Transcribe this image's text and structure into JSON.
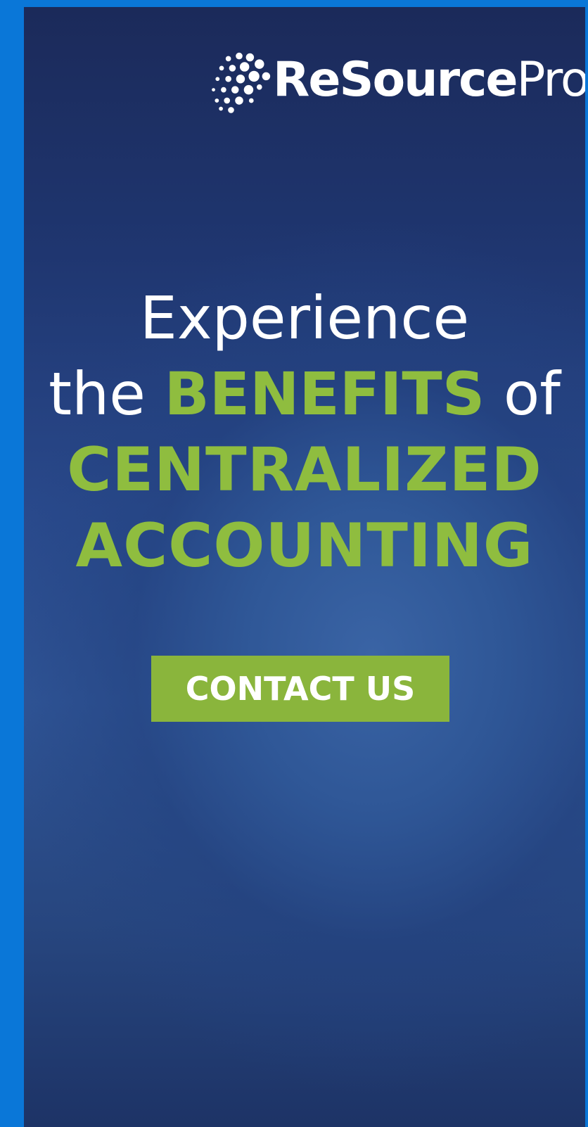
{
  "brand": {
    "name_bold": "ReSource",
    "name_light": "Pro",
    "logo_icon": "dotted-globe-icon",
    "frame_color": "#0a77d8",
    "background_dark": "#1b2a5a",
    "background_light": "#3a64a5"
  },
  "headline": {
    "line1": "Experience",
    "line2_prefix": "the ",
    "line2_accent": "BENEFITS",
    "line2_suffix": " of",
    "line3": "CENTRALIZED",
    "line4": "ACCOUNTING",
    "accent_color": "#8fbd3f"
  },
  "cta": {
    "label": "CONTACT US",
    "background": "#8ab53c"
  }
}
